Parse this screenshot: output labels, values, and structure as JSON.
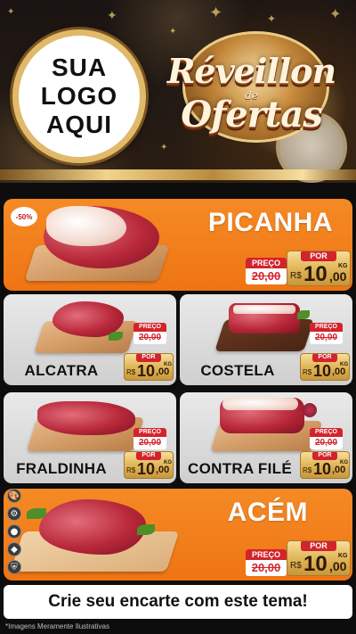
{
  "header": {
    "logo_lines": [
      "SUA",
      "LOGO",
      "AQUI"
    ],
    "title_line1": "Réveillon",
    "title_de": "de",
    "title_line2": "Ofertas"
  },
  "price_labels": {
    "old": "PREÇO",
    "new": "POR",
    "currency": "R$",
    "unit": "KG"
  },
  "products": [
    {
      "name": "PICANHA",
      "old_price": "20,00",
      "price_int": "10",
      "price_dec": ",00",
      "discount": "-50%"
    },
    {
      "name": "ALCATRA",
      "old_price": "20,00",
      "price_int": "10",
      "price_dec": ",00"
    },
    {
      "name": "COSTELA",
      "old_price": "20,00",
      "price_int": "10",
      "price_dec": ",00"
    },
    {
      "name": "FRALDINHA",
      "old_price": "20,00",
      "price_int": "10",
      "price_dec": ",00"
    },
    {
      "name": "CONTRA FILÉ",
      "old_price": "20,00",
      "price_int": "10",
      "price_dec": ",00"
    },
    {
      "name": "ACÉM",
      "old_price": "20,00",
      "price_int": "10",
      "price_dec": ",00"
    }
  ],
  "side_tools": [
    {
      "icon": "palette-icon",
      "glyph": "🎨"
    },
    {
      "icon": "settings-icon",
      "glyph": "⚙"
    },
    {
      "icon": "badge-icon",
      "glyph": "●"
    },
    {
      "icon": "tag-icon",
      "glyph": "◆"
    },
    {
      "icon": "shield-icon",
      "glyph": "⛨"
    }
  ],
  "cta": "Crie seu encarte com este tema!",
  "disclaimer": "*Imagens Meramente Ilustrativas",
  "colors": {
    "orange": "#f07a18",
    "red": "#d3232b",
    "gold": "#e2b65a"
  }
}
